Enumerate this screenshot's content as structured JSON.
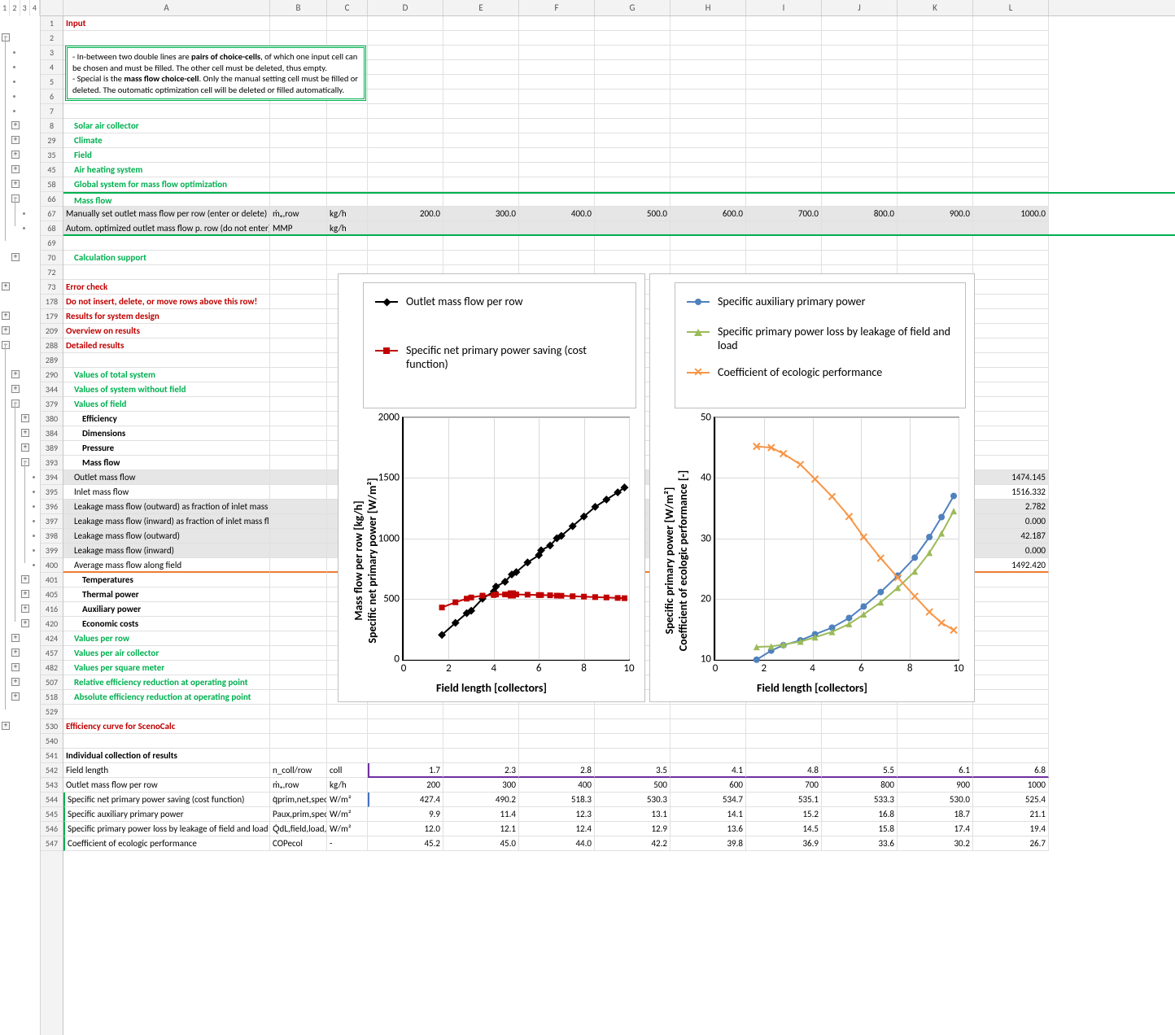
{
  "columns": [
    "A",
    "B",
    "C",
    "D",
    "E",
    "F",
    "G",
    "H",
    "I",
    "J",
    "K",
    "L"
  ],
  "outline_levels": [
    "1",
    "2",
    "3",
    "4"
  ],
  "rows": [
    {
      "n": 1,
      "A": "Input",
      "cls": "red bold"
    },
    {
      "n": 2
    },
    {
      "n": 3
    },
    {
      "n": 4
    },
    {
      "n": 5
    },
    {
      "n": 6
    },
    {
      "n": 7
    },
    {
      "n": 8,
      "A": "Solar air collector",
      "cls": "greenbold",
      "indent": 1
    },
    {
      "n": 29,
      "A": "Climate",
      "cls": "greenbold",
      "indent": 1
    },
    {
      "n": 35,
      "A": "Field",
      "cls": "greenbold",
      "indent": 1
    },
    {
      "n": 45,
      "A": "Air heating system",
      "cls": "greenbold",
      "indent": 1
    },
    {
      "n": 58,
      "A": "Global system for mass flow optimization",
      "cls": "greenbold",
      "indent": 1
    },
    {
      "n": 66,
      "A": "Mass flow",
      "cls": "greenbold",
      "indent": 1,
      "mftop": true
    },
    {
      "n": 67,
      "A": "Manually set outlet mass flow per row (enter or delete)",
      "B": "ṁₑ,row",
      "C": "kg/h",
      "D": "200.0",
      "E": "300.0",
      "F": "400.0",
      "G": "500.0",
      "H": "600.0",
      "I": "700.0",
      "J": "800.0",
      "K": "900.0",
      "L": "1000.0",
      "shaded": true
    },
    {
      "n": 68,
      "A": "Autom. optimized outlet mass flow p. row (do not enter)",
      "B": "MMP",
      "C": "kg/h",
      "shaded": true,
      "mfbot": true
    },
    {
      "n": 69
    },
    {
      "n": 70,
      "A": "Calculation support",
      "cls": "greenbold",
      "indent": 1
    },
    {
      "n": 72
    },
    {
      "n": 73,
      "A": "Error check",
      "cls": "red bold"
    },
    {
      "n": 178,
      "A": "Do not insert, delete, or move rows above this row!",
      "cls": "red bold"
    },
    {
      "n": 179,
      "A": "Results for system design",
      "cls": "red bold"
    },
    {
      "n": 209,
      "A": "Overview on results",
      "cls": "red bold"
    },
    {
      "n": 288,
      "A": "Detailed results",
      "cls": "red bold"
    },
    {
      "n": 289
    },
    {
      "n": 290,
      "A": "Values of total system",
      "cls": "greenbold",
      "indent": 1
    },
    {
      "n": 344,
      "A": "Values of system without field",
      "cls": "greenbold",
      "indent": 1
    },
    {
      "n": 379,
      "A": "Values of field",
      "cls": "greenbold",
      "indent": 1
    },
    {
      "n": 380,
      "A": "Efficiency",
      "cls": "bold",
      "indent": 2
    },
    {
      "n": 384,
      "A": "Dimensions",
      "cls": "bold",
      "indent": 2
    },
    {
      "n": 389,
      "A": "Pressure",
      "cls": "bold",
      "indent": 2
    },
    {
      "n": 393,
      "A": "Mass flow",
      "cls": "bold",
      "indent": 2
    },
    {
      "n": 394,
      "A": "Outlet mass flow",
      "indent": 1,
      "shaded": true,
      "L": "1474.145"
    },
    {
      "n": 395,
      "A": "Inlet mass flow",
      "indent": 1,
      "L": "1516.332"
    },
    {
      "n": 396,
      "A": "Leakage mass flow (outward) as fraction of inlet mass flow",
      "indent": 1,
      "shaded": true,
      "L": "2.782"
    },
    {
      "n": 397,
      "A": "Leakage mass flow (inward) as fraction of inlet mass flow",
      "indent": 1,
      "shaded": true,
      "L": "0.000"
    },
    {
      "n": 398,
      "A": "Leakage mass flow (outward)",
      "indent": 1,
      "shaded": true,
      "L": "42.187"
    },
    {
      "n": 399,
      "A": "Leakage mass flow (inward)",
      "indent": 1,
      "shaded": true,
      "L": "0.000"
    },
    {
      "n": 400,
      "A": "Average mass flow along field",
      "indent": 1,
      "L": "1492.420",
      "orangebot": true
    },
    {
      "n": 401,
      "A": "Temperatures",
      "cls": "bold",
      "indent": 2
    },
    {
      "n": 405,
      "A": "Thermal power",
      "cls": "bold",
      "indent": 2
    },
    {
      "n": 416,
      "A": "Auxiliary power",
      "cls": "bold",
      "indent": 2
    },
    {
      "n": 420,
      "A": "Economic costs",
      "cls": "bold",
      "indent": 2
    },
    {
      "n": 424,
      "A": "Values per row",
      "cls": "greenbold",
      "indent": 1
    },
    {
      "n": 457,
      "A": "Values per air collector",
      "cls": "greenbold",
      "indent": 1
    },
    {
      "n": 482,
      "A": "Values per square meter",
      "cls": "greenbold",
      "indent": 1
    },
    {
      "n": 507,
      "A": "Relative efficiency reduction at operating point",
      "cls": "greenbold",
      "indent": 1
    },
    {
      "n": 518,
      "A": "Absolute efficiency reduction at operating point",
      "cls": "greenbold",
      "indent": 1
    },
    {
      "n": 529
    },
    {
      "n": 530,
      "A": "Efficiency curve for ScenoCalc",
      "cls": "red bold"
    },
    {
      "n": 540
    },
    {
      "n": 541,
      "A": "Individual collection of results",
      "cls": "bold"
    },
    {
      "n": 542,
      "A": "Field length",
      "B": "n_coll/row",
      "C": "coll",
      "D": "1.7",
      "E": "2.3",
      "F": "2.8",
      "G": "3.5",
      "H": "4.1",
      "I": "4.8",
      "J": "5.5",
      "K": "6.1",
      "L": "6.8",
      "purplebot": true,
      "purpleleft": true
    },
    {
      "n": 543,
      "A": "Outlet mass flow per row",
      "B": "ṁₑ,row",
      "C": "kg/h",
      "D": "200",
      "E": "300",
      "F": "400",
      "G": "500",
      "H": "600",
      "I": "700",
      "J": "800",
      "K": "900",
      "L": "1000"
    },
    {
      "n": 544,
      "A": "Specific net primary power saving (cost function)",
      "B": "q̇prim,net,spec",
      "C": "W/m²",
      "D": "427.4",
      "E": "490.2",
      "F": "518.3",
      "G": "530.3",
      "H": "534.7",
      "I": "535.1",
      "J": "533.3",
      "K": "530.0",
      "L": "525.4",
      "greenA": true,
      "blueleft": true
    },
    {
      "n": 545,
      "A": "Specific auxiliary primary power",
      "B": "Paux,prim,spec",
      "C": "W/m²",
      "D": "9.9",
      "E": "11.4",
      "F": "12.3",
      "G": "13.1",
      "H": "14.1",
      "I": "15.2",
      "J": "16.8",
      "K": "18.7",
      "L": "21.1",
      "greenA": true
    },
    {
      "n": 546,
      "A": "Specific primary power loss by leakage of field and load",
      "B": "Q̇dL,field,load,spec",
      "C": "W/m²",
      "D": "12.0",
      "E": "12.1",
      "F": "12.4",
      "G": "12.9",
      "H": "13.6",
      "I": "14.5",
      "J": "15.8",
      "K": "17.4",
      "L": "19.4",
      "greenA": true
    },
    {
      "n": 547,
      "A": "Coefficient of ecologic performance",
      "B": "COPecol",
      "C": "-",
      "D": "45.2",
      "E": "45.0",
      "F": "44.0",
      "G": "42.2",
      "H": "39.8",
      "I": "36.9",
      "J": "33.6",
      "K": "30.2",
      "L": "26.7",
      "greenA": true
    }
  ],
  "notebox_text": "- In-between two double lines are pairs of choice-cells, of which one input cell can be chosen and must be filled. The other cell must be deleted, thus empty.\n- Special is the mass flow choice-cell. Only the manual setting cell must be filled or deleted. The outomatic optimization cell will be deleted or filled automatically.",
  "chart1": {
    "legend": [
      {
        "marker": "diamond",
        "label": "Outlet mass flow per row"
      },
      {
        "marker": "square",
        "label": "Specific net primary power saving (cost function)"
      }
    ],
    "ylabel": "Mass flow per row [kg/h]\nSpecific net primary power [W/m²]",
    "xlabel": "Field length [collectors]",
    "yticks": [
      0,
      500,
      1000,
      1500,
      2000
    ],
    "xticks": [
      0,
      2,
      4,
      6,
      8,
      10
    ]
  },
  "chart2": {
    "legend": [
      {
        "marker": "circle",
        "label": "Specific auxiliary primary power"
      },
      {
        "marker": "triangle",
        "label": "Specific primary power loss by leakage of field and load"
      },
      {
        "marker": "cross",
        "label": "Coefficient of ecologic performance"
      }
    ],
    "ylabel": "Specific primary power [W/m²]\nCoefficient of ecologic performance [-]",
    "xlabel": "Field length [collectors]",
    "yticks": [
      10,
      20,
      30,
      40,
      50
    ],
    "xticks": [
      0,
      2,
      4,
      6,
      8,
      10
    ]
  },
  "chart_data": [
    {
      "type": "line",
      "title": "",
      "xlabel": "Field length [collectors]",
      "ylabel": "Mass flow per row [kg/h] / Specific net primary power [W/m²]",
      "xlim": [
        0,
        10
      ],
      "ylim": [
        0,
        2000
      ],
      "x": [
        1.7,
        2.3,
        2.8,
        3.0,
        3.5,
        4.0,
        4.1,
        4.5,
        4.8,
        5.0,
        5.5,
        6.0,
        6.1,
        6.5,
        6.8,
        7.0,
        7.5,
        8.0,
        8.5,
        9.0,
        9.5,
        9.8
      ],
      "series": [
        {
          "name": "Outlet mass flow per row",
          "values": [
            200,
            300,
            380,
            400,
            500,
            560,
            600,
            640,
            700,
            720,
            800,
            860,
            900,
            940,
            1000,
            1020,
            1100,
            1180,
            1260,
            1320,
            1380,
            1420
          ]
        },
        {
          "name": "Specific net primary power saving (cost function)",
          "values": [
            427,
            470,
            500,
            510,
            525,
            530,
            535,
            535,
            535,
            535,
            533,
            530,
            530,
            528,
            525,
            524,
            520,
            517,
            513,
            510,
            506,
            504
          ]
        }
      ]
    },
    {
      "type": "line",
      "title": "",
      "xlabel": "Field length [collectors]",
      "ylabel": "Specific primary power [W/m²] / Coefficient of ecologic performance [-]",
      "xlim": [
        0,
        10
      ],
      "ylim": [
        10,
        50
      ],
      "x": [
        1.7,
        2.3,
        2.8,
        3.5,
        4.1,
        4.8,
        5.5,
        6.1,
        6.8,
        7.5,
        8.2,
        8.8,
        9.3,
        9.8
      ],
      "series": [
        {
          "name": "Specific auxiliary primary power",
          "values": [
            9.9,
            11.4,
            12.3,
            13.1,
            14.1,
            15.2,
            16.8,
            18.7,
            21.1,
            23.8,
            26.8,
            30.2,
            33.5,
            37.0
          ]
        },
        {
          "name": "Specific primary power loss by leakage of field and load",
          "values": [
            12.0,
            12.1,
            12.4,
            12.9,
            13.6,
            14.5,
            15.8,
            17.4,
            19.4,
            21.8,
            24.5,
            27.6,
            30.8,
            34.5
          ]
        },
        {
          "name": "Coefficient of ecologic performance",
          "values": [
            45.2,
            45.0,
            44.0,
            42.2,
            39.8,
            36.9,
            33.6,
            30.2,
            26.7,
            23.5,
            20.4,
            17.8,
            16.0,
            14.8
          ]
        }
      ]
    }
  ]
}
